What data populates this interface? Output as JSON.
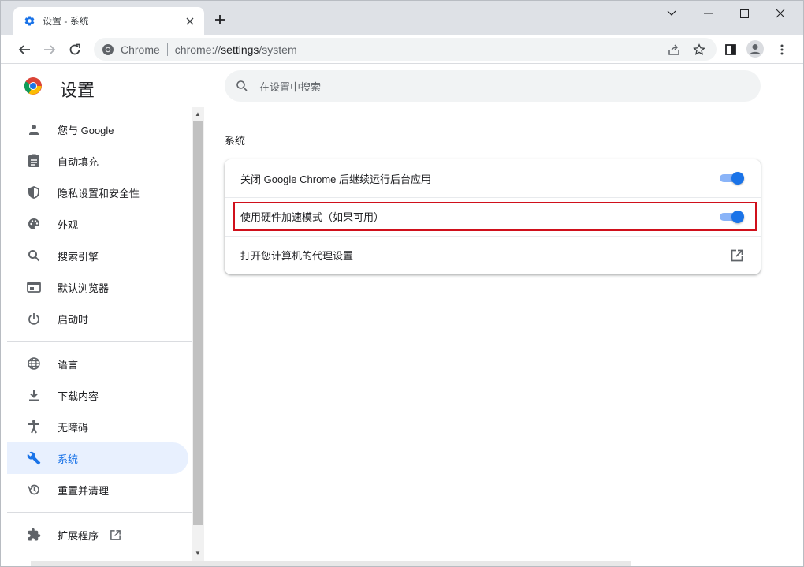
{
  "tab": {
    "title": "设置 - 系统",
    "favicon": "gear-icon"
  },
  "toolbar": {
    "site_label": "Chrome",
    "url_scheme": "chrome://",
    "url_host": "settings",
    "url_path": "/system"
  },
  "header": {
    "title": "设置"
  },
  "search": {
    "placeholder": "在设置中搜索"
  },
  "sidebar": {
    "items": [
      {
        "label": "您与 Google",
        "icon": "person-icon"
      },
      {
        "label": "自动填充",
        "icon": "clipboard-icon"
      },
      {
        "label": "隐私设置和安全性",
        "icon": "shield-icon"
      },
      {
        "label": "外观",
        "icon": "palette-icon"
      },
      {
        "label": "搜索引擎",
        "icon": "search-icon"
      },
      {
        "label": "默认浏览器",
        "icon": "browser-icon"
      },
      {
        "label": "启动时",
        "icon": "power-icon"
      },
      {
        "label": "语言",
        "icon": "globe-icon"
      },
      {
        "label": "下载内容",
        "icon": "download-icon"
      },
      {
        "label": "无障碍",
        "icon": "accessibility-icon"
      },
      {
        "label": "系统",
        "icon": "wrench-icon",
        "active": true
      },
      {
        "label": "重置并清理",
        "icon": "history-icon"
      },
      {
        "label": "扩展程序",
        "icon": "puzzle-icon"
      }
    ]
  },
  "main": {
    "section_title": "系统",
    "rows": [
      {
        "label": "关闭 Google Chrome 后继续运行后台应用",
        "control": "toggle",
        "on": true
      },
      {
        "label": "使用硬件加速模式（如果可用）",
        "control": "toggle",
        "on": true,
        "highlighted": true
      },
      {
        "label": "打开您计算机的代理设置",
        "control": "external-link"
      }
    ]
  },
  "colors": {
    "accent": "#1a73e8",
    "accent_light": "#8ab4f8",
    "active_bg": "#e8f0fe",
    "highlight_border": "#d0101b"
  }
}
